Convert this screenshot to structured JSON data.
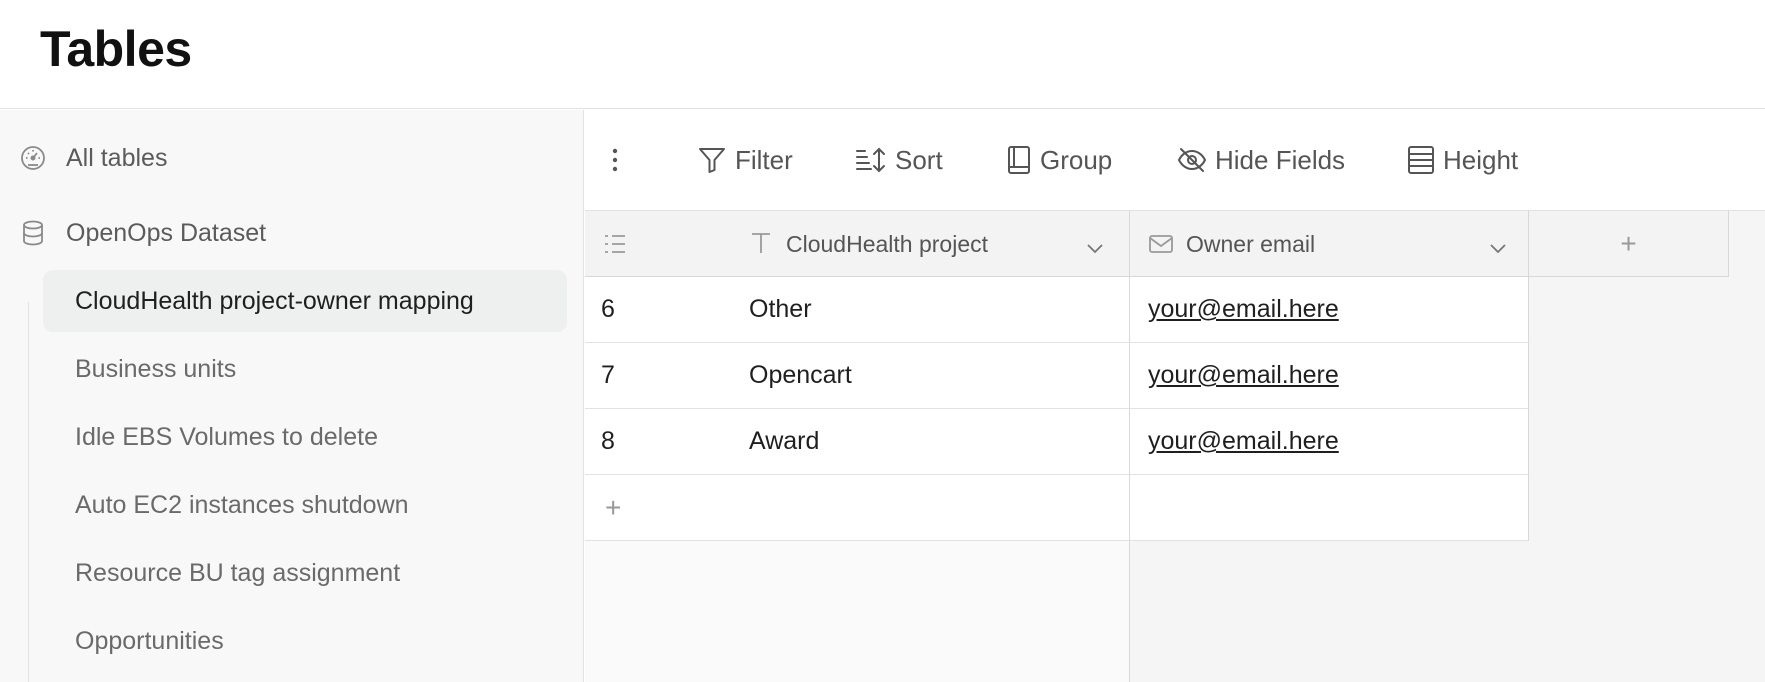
{
  "header": {
    "title": "Tables"
  },
  "sidebar": {
    "all_tables": "All tables",
    "dataset": "OpenOps Dataset",
    "tables": [
      "CloudHealth project-owner mapping",
      "Business units",
      "Idle EBS Volumes to delete",
      "Auto EC2 instances shutdown",
      "Resource BU tag assignment",
      "Opportunities"
    ],
    "active_index": 0
  },
  "toolbar": {
    "filter": "Filter",
    "sort": "Sort",
    "group": "Group",
    "hide_fields": "Hide Fields",
    "height": "Height"
  },
  "grid": {
    "columns": [
      "CloudHealth project",
      "Owner email"
    ],
    "add_column": "+",
    "add_row": "+",
    "rows": [
      {
        "id": "6",
        "project": "Other",
        "email": "your@email.here"
      },
      {
        "id": "7",
        "project": "Opencart",
        "email": "your@email.here"
      },
      {
        "id": "8",
        "project": "Award",
        "email": "your@email.here"
      }
    ]
  },
  "icons": {
    "all_tables": "dashboard-icon",
    "dataset": "database-icon",
    "more": "kebab-icon",
    "filter": "filter-icon",
    "sort": "sort-icon",
    "group": "group-icon",
    "hide_fields": "eye-off-icon",
    "height": "row-height-icon",
    "row_number": "list-icon",
    "text_field": "text-type-icon",
    "email_field": "mail-icon",
    "dropdown": "chevron-down-icon"
  }
}
